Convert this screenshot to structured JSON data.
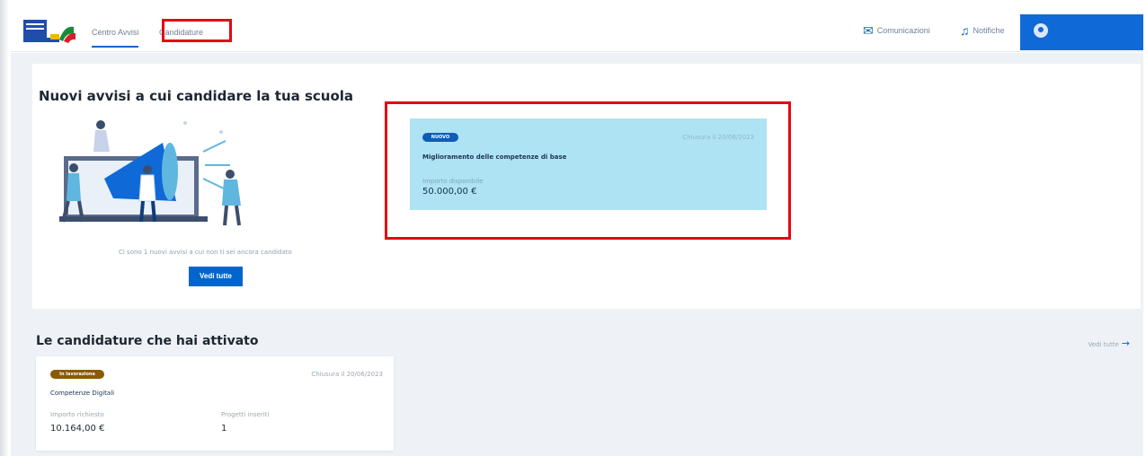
{
  "nav": {
    "tabs": [
      {
        "label": "Centro Avvisi",
        "active": true
      },
      {
        "label": "Candidature",
        "active": false
      }
    ],
    "communications_label": "Comunicazioni",
    "notifications_label": "Notifiche",
    "icons": {
      "communications": "megaphone-icon",
      "notifications": "bell-icon",
      "user": "user-avatar-icon"
    }
  },
  "notices": {
    "title": "Nuovi avvisi a cui candidare la tua scuola",
    "caption": "Ci sono 1 nuovi avvisi a cui non ti sei ancora candidato",
    "view_all_label": "Vedi tutte",
    "card": {
      "badge": "NUOVO",
      "date": "Chiusura il 20/06/2023",
      "title": "Miglioramento delle competenze di base",
      "amount_label": "Importo disponibile",
      "amount": "50.000,00 €"
    }
  },
  "applications": {
    "title": "Le candidature che hai attivato",
    "see_all_label": "Vedi tutte",
    "card": {
      "status": "In lavorazione",
      "date": "Chiusura il 20/06/2023",
      "title": "Competenze Digitali",
      "amount_label": "Importo richiesto",
      "amount": "10.164,00 €",
      "projects_label": "Progetti inseriti",
      "projects": "1"
    }
  },
  "colors": {
    "primary": "#0066cc",
    "highlight": "#e30613",
    "notice_card": "#aee3f3",
    "status_badge": "#8a5a00"
  }
}
